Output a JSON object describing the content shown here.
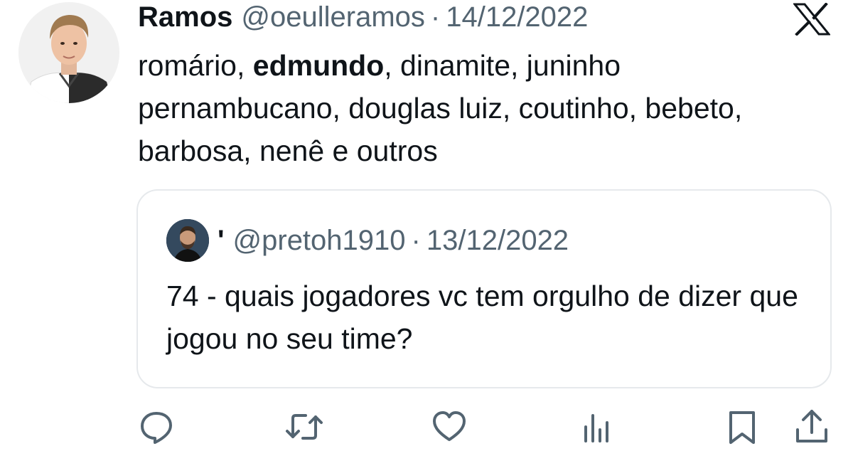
{
  "tweet": {
    "display_name": "Ramos",
    "handle": "@oeulleramos",
    "separator": "·",
    "date": "14/12/2022",
    "text": {
      "part1": "romário, ",
      "bold": "edmundo",
      "part2": ", dinamite, juninho pernambucano, douglas luiz, coutinho, bebeto, barbosa, nenê e outros"
    }
  },
  "quoted_tweet": {
    "display_name": "'",
    "handle": "@pretoh1910",
    "separator": "·",
    "date": "13/12/2022",
    "text": "74 - quais jogadores vc tem orgulho de dizer que jogou no seu time?"
  },
  "actions": {
    "icons": [
      "reply-icon",
      "retweet-icon",
      "like-icon",
      "views-icon",
      "bookmark-icon",
      "share-icon"
    ],
    "color": "#536471"
  },
  "colors": {
    "text": "#0f1419",
    "muted": "#536471",
    "border": "#e6e9ec"
  }
}
